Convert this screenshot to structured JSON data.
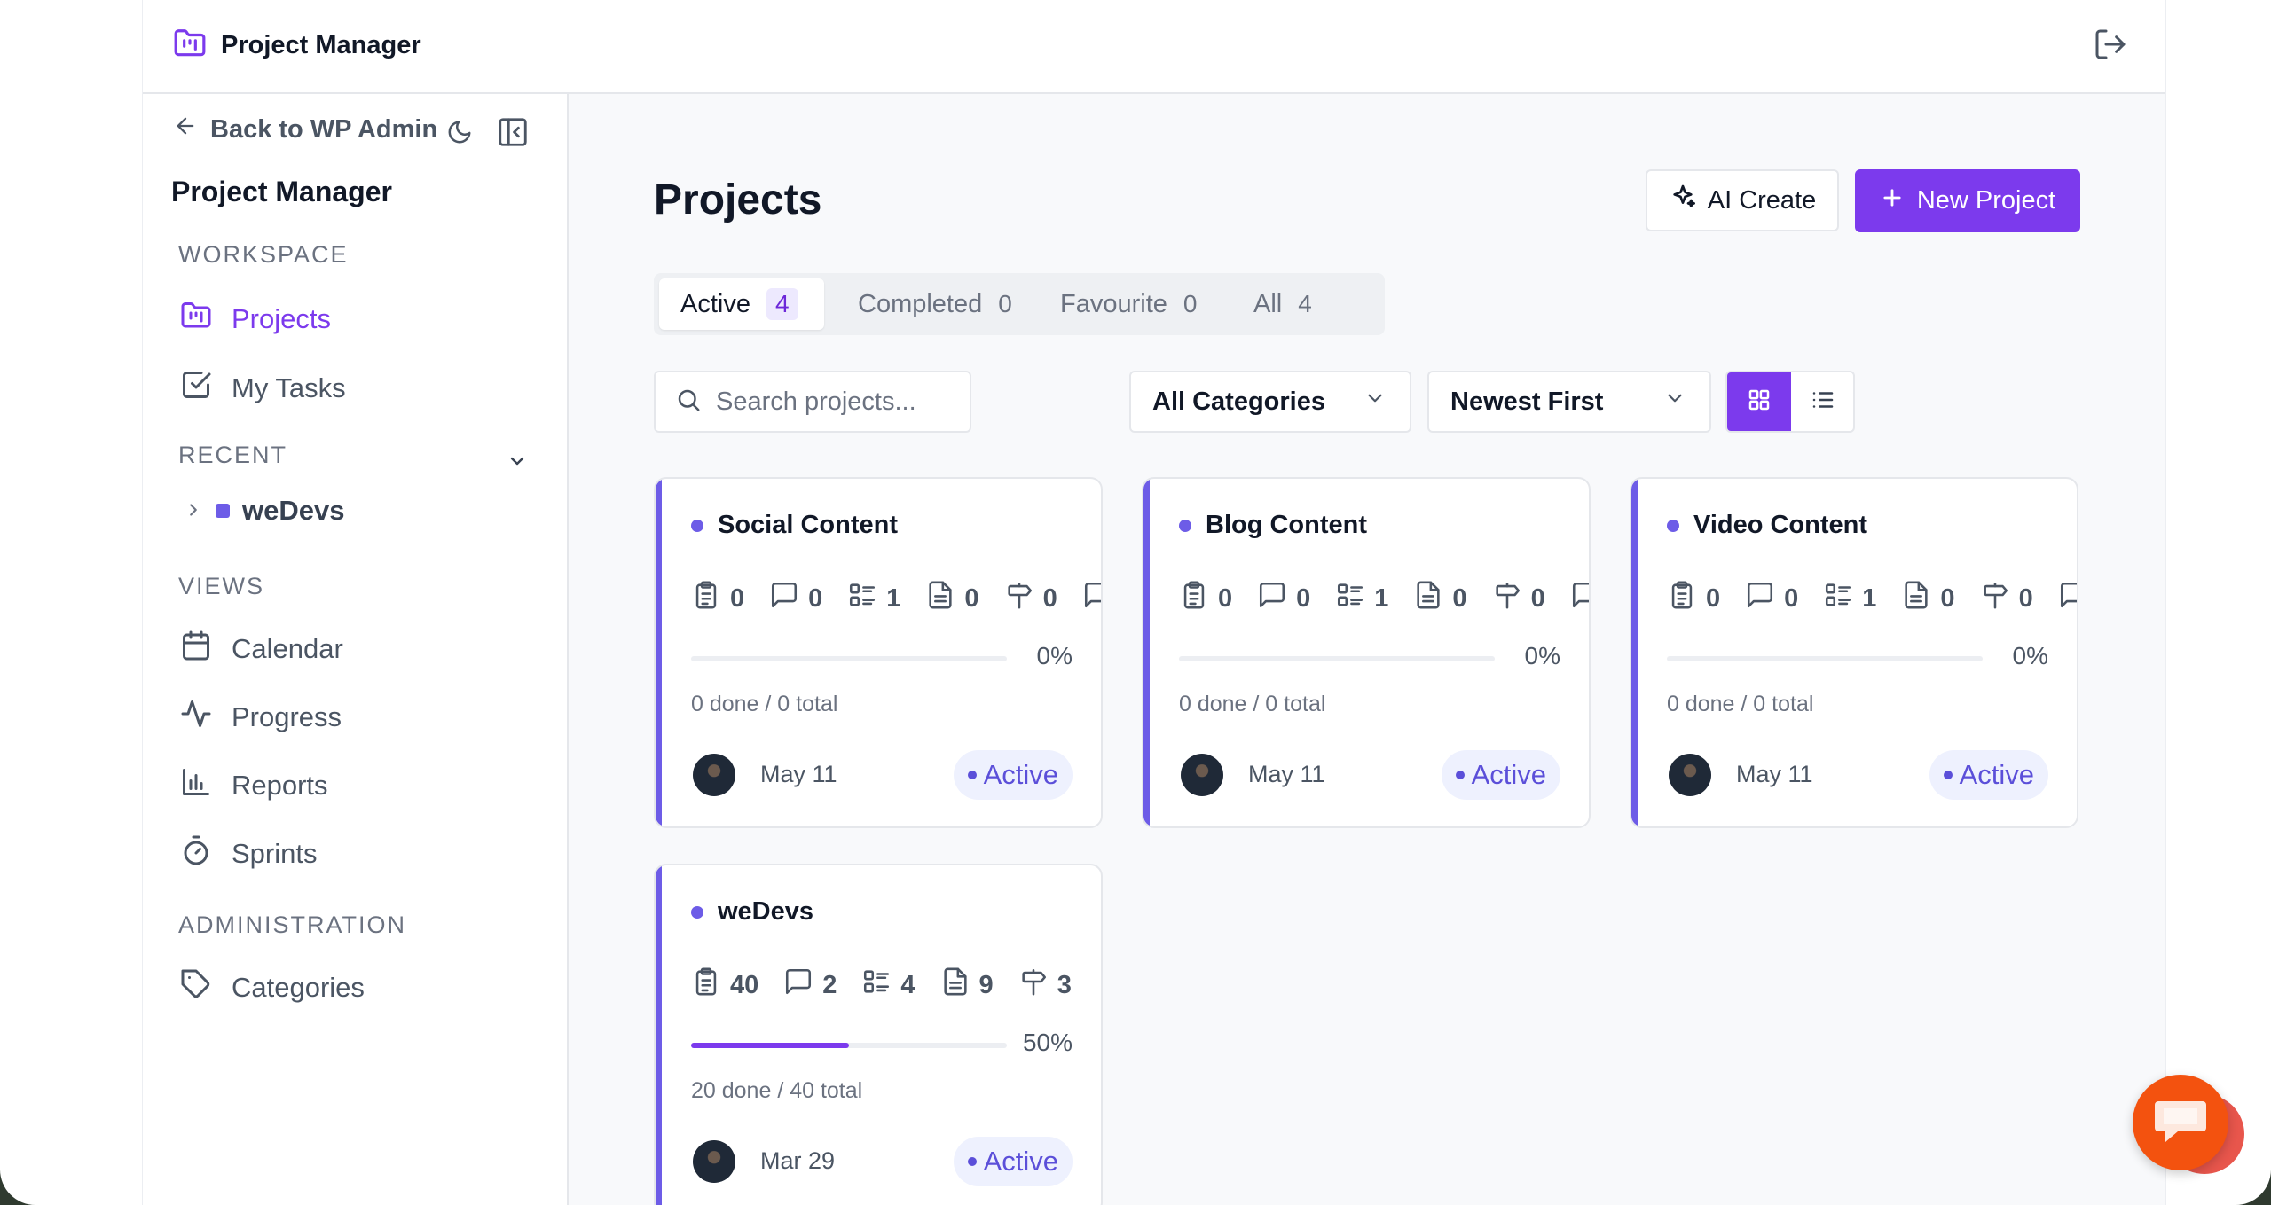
{
  "app": {
    "title": "Project Manager"
  },
  "sidebar": {
    "back_label": "Back to WP Admin",
    "title": "Project Manager",
    "workspace_heading": "WORKSPACE",
    "workspace_items": [
      {
        "label": "Projects"
      },
      {
        "label": "My Tasks"
      }
    ],
    "recent_heading": "RECENT",
    "recent_items": [
      {
        "label": "weDevs"
      }
    ],
    "views_heading": "VIEWS",
    "views_items": [
      {
        "label": "Calendar"
      },
      {
        "label": "Progress"
      },
      {
        "label": "Reports"
      },
      {
        "label": "Sprints"
      }
    ],
    "admin_heading": "ADMINISTRATION",
    "admin_items": [
      {
        "label": "Categories"
      }
    ]
  },
  "main": {
    "title": "Projects",
    "ai_create_label": "AI Create",
    "new_project_label": "New Project",
    "tabs": [
      {
        "label": "Active",
        "count": "4"
      },
      {
        "label": "Completed",
        "count": "0"
      },
      {
        "label": "Favourite",
        "count": "0"
      },
      {
        "label": "All",
        "count": "4"
      }
    ],
    "search_placeholder": "Search projects...",
    "category_select": "All Categories",
    "sort_select": "Newest First",
    "accent_color": "#7c3aed"
  },
  "projects": [
    {
      "name": "Social Content",
      "tasks": "0",
      "comments": "0",
      "lists": "1",
      "files": "0",
      "milestones": "0",
      "progress": 0,
      "progress_label": "0%",
      "done_text": "0 done / 0 total",
      "date": "May 11",
      "status": "Active"
    },
    {
      "name": "Blog Content",
      "tasks": "0",
      "comments": "0",
      "lists": "1",
      "files": "0",
      "milestones": "0",
      "progress": 0,
      "progress_label": "0%",
      "done_text": "0 done / 0 total",
      "date": "May 11",
      "status": "Active"
    },
    {
      "name": "Video Content",
      "tasks": "0",
      "comments": "0",
      "lists": "1",
      "files": "0",
      "milestones": "0",
      "progress": 0,
      "progress_label": "0%",
      "done_text": "0 done / 0 total",
      "date": "May 11",
      "status": "Active"
    },
    {
      "name": "weDevs",
      "tasks": "40",
      "comments": "2",
      "lists": "4",
      "files": "9",
      "milestones": "3",
      "progress": 50,
      "progress_label": "50%",
      "done_text": "20 done / 40 total",
      "date": "Mar 29",
      "status": "Active"
    }
  ]
}
